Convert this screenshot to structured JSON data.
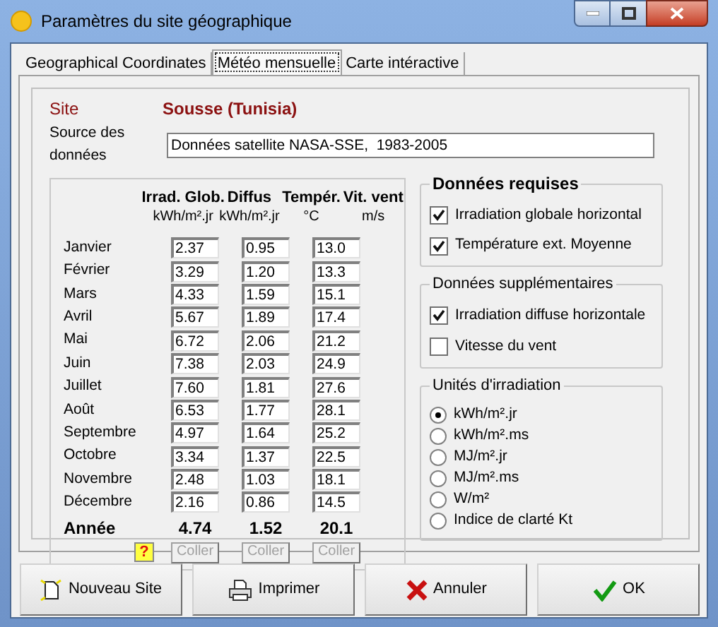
{
  "window": {
    "title": "Paramètres du site géographique"
  },
  "tabs": [
    {
      "label": "Geographical Coordinates",
      "selected": false
    },
    {
      "label": "Météo mensuelle",
      "selected": true
    },
    {
      "label": "Carte intéractive",
      "selected": false
    }
  ],
  "site": {
    "label": "Site",
    "name": "Sousse",
    "country": "(Tunisia)"
  },
  "source": {
    "label": "Source des données",
    "value": "Données satellite NASA-SSE,  1983-2005"
  },
  "table": {
    "columns": [
      {
        "title": "Irrad. Glob.",
        "unit": "kWh/m².jr"
      },
      {
        "title": "Diffus",
        "unit": "kWh/m².jr"
      },
      {
        "title": "Tempér.",
        "unit": "°C"
      },
      {
        "title": "Vit. vent",
        "unit": "m/s"
      }
    ],
    "rows": [
      {
        "month": "Janvier",
        "values": [
          "2.37",
          "0.95",
          "13.0"
        ]
      },
      {
        "month": "Février",
        "values": [
          "3.29",
          "1.20",
          "13.3"
        ]
      },
      {
        "month": "Mars",
        "values": [
          "4.33",
          "1.59",
          "15.1"
        ]
      },
      {
        "month": "Avril",
        "values": [
          "5.67",
          "1.89",
          "17.4"
        ]
      },
      {
        "month": "Mai",
        "values": [
          "6.72",
          "2.06",
          "21.2"
        ]
      },
      {
        "month": "Juin",
        "values": [
          "7.38",
          "2.03",
          "24.9"
        ]
      },
      {
        "month": "Juillet",
        "values": [
          "7.60",
          "1.81",
          "27.6"
        ]
      },
      {
        "month": "Août",
        "values": [
          "6.53",
          "1.77",
          "28.1"
        ]
      },
      {
        "month": "Septembre",
        "values": [
          "4.97",
          "1.64",
          "25.2"
        ]
      },
      {
        "month": "Octobre",
        "values": [
          "3.34",
          "1.37",
          "22.5"
        ]
      },
      {
        "month": "Novembre",
        "values": [
          "2.48",
          "1.03",
          "18.1"
        ]
      },
      {
        "month": "Décembre",
        "values": [
          "2.16",
          "0.86",
          "14.5"
        ]
      }
    ],
    "totals": {
      "label": "Année",
      "values": [
        "4.74",
        "1.52",
        "20.1"
      ]
    },
    "help_button": "?",
    "paste_buttons": [
      {
        "label": "Coller",
        "disabled": true
      },
      {
        "label": "Coller",
        "disabled": true
      },
      {
        "label": "Coller",
        "disabled": true
      }
    ]
  },
  "required": {
    "title": "Données requises",
    "items": [
      {
        "label": "Irradiation globale horizontal",
        "checked": true
      },
      {
        "label": "Température ext. Moyenne",
        "checked": true
      }
    ]
  },
  "extra": {
    "title": "Données supplémentaires",
    "items": [
      {
        "label": "Irradiation diffuse horizontale",
        "checked": true
      },
      {
        "label": "Vitesse du vent",
        "checked": false
      }
    ]
  },
  "units": {
    "title": "Unités d'irradiation",
    "options": [
      {
        "label": "kWh/m².jr",
        "selected": true
      },
      {
        "label": "kWh/m².ms",
        "selected": false
      },
      {
        "label": "MJ/m².jr",
        "selected": false
      },
      {
        "label": "MJ/m².ms",
        "selected": false
      },
      {
        "label": "W/m²",
        "selected": false
      },
      {
        "label": "Indice de clarté Kt",
        "selected": false
      }
    ]
  },
  "buttons": [
    {
      "label": "Nouveau Site",
      "kind": "new"
    },
    {
      "label": "Imprimer",
      "kind": "print"
    },
    {
      "label": "Annuler",
      "kind": "cancel"
    },
    {
      "label": "OK",
      "kind": "ok"
    }
  ]
}
